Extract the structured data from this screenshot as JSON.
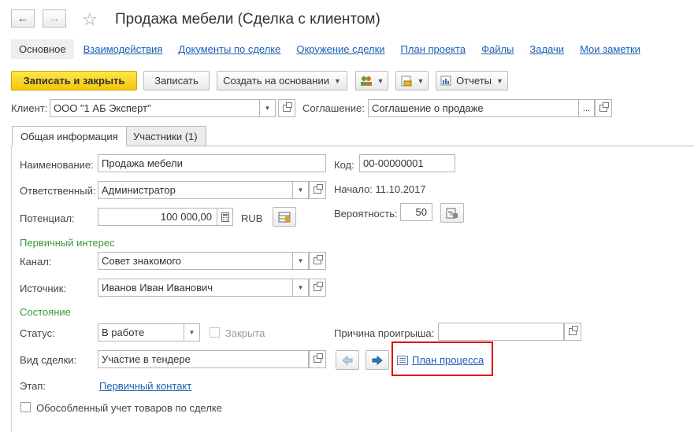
{
  "window": {
    "title": "Продажа мебели (Сделка с клиентом)"
  },
  "nav_tabs": [
    {
      "label": "Основное",
      "active": true
    },
    {
      "label": "Взаимодействия"
    },
    {
      "label": "Документы по сделке"
    },
    {
      "label": "Окружение сделки"
    },
    {
      "label": "План проекта"
    },
    {
      "label": "Файлы"
    },
    {
      "label": "Задачи"
    },
    {
      "label": "Мои заметки"
    }
  ],
  "toolbar": {
    "save_close": "Записать и закрыть",
    "save": "Записать",
    "create_based": "Создать на основании",
    "reports": "Отчеты"
  },
  "header": {
    "client_label": "Клиент:",
    "client_value": "ООО \"1 АБ Эксперт\"",
    "agreement_label": "Соглашение:",
    "agreement_value": "Соглашение о продаже",
    "dots": "..."
  },
  "tabs": [
    {
      "label": "Общая информация",
      "active": true
    },
    {
      "label": "Участники (1)"
    }
  ],
  "form": {
    "name_label": "Наименование:",
    "name_value": "Продажа мебели",
    "code_label": "Код:",
    "code_value": "00-00000001",
    "responsible_label": "Ответственный:",
    "responsible_value": "Администратор",
    "start_text": "Начало: 11.10.2017",
    "potential_label": "Потенциал:",
    "potential_value": "100 000,00",
    "currency": "RUB",
    "probability_label": "Вероятность:",
    "probability_value": "50",
    "primary_interest": "Первичный интерес",
    "channel_label": "Канал:",
    "channel_value": "Совет знакомого",
    "source_label": "Источник:",
    "source_value": "Иванов Иван Иванович",
    "state_section": "Состояние",
    "status_label": "Статус:",
    "status_value": "В работе",
    "closed_label": "Закрыта",
    "loss_reason_label": "Причина проигрыша:",
    "loss_reason_value": "",
    "deal_type_label": "Вид сделки:",
    "deal_type_value": "Участие в тендере",
    "process_plan_link": "План процесса",
    "stage_label": "Этап:",
    "stage_value": "Первичный контакт",
    "separate_accounting": "Обособленный учет товаров по сделке"
  },
  "colors": {
    "accent_link": "#1a5fb4",
    "section_green": "#3a9a3a",
    "primary_button": "#f3c60a",
    "highlight_red": "#e00000"
  }
}
